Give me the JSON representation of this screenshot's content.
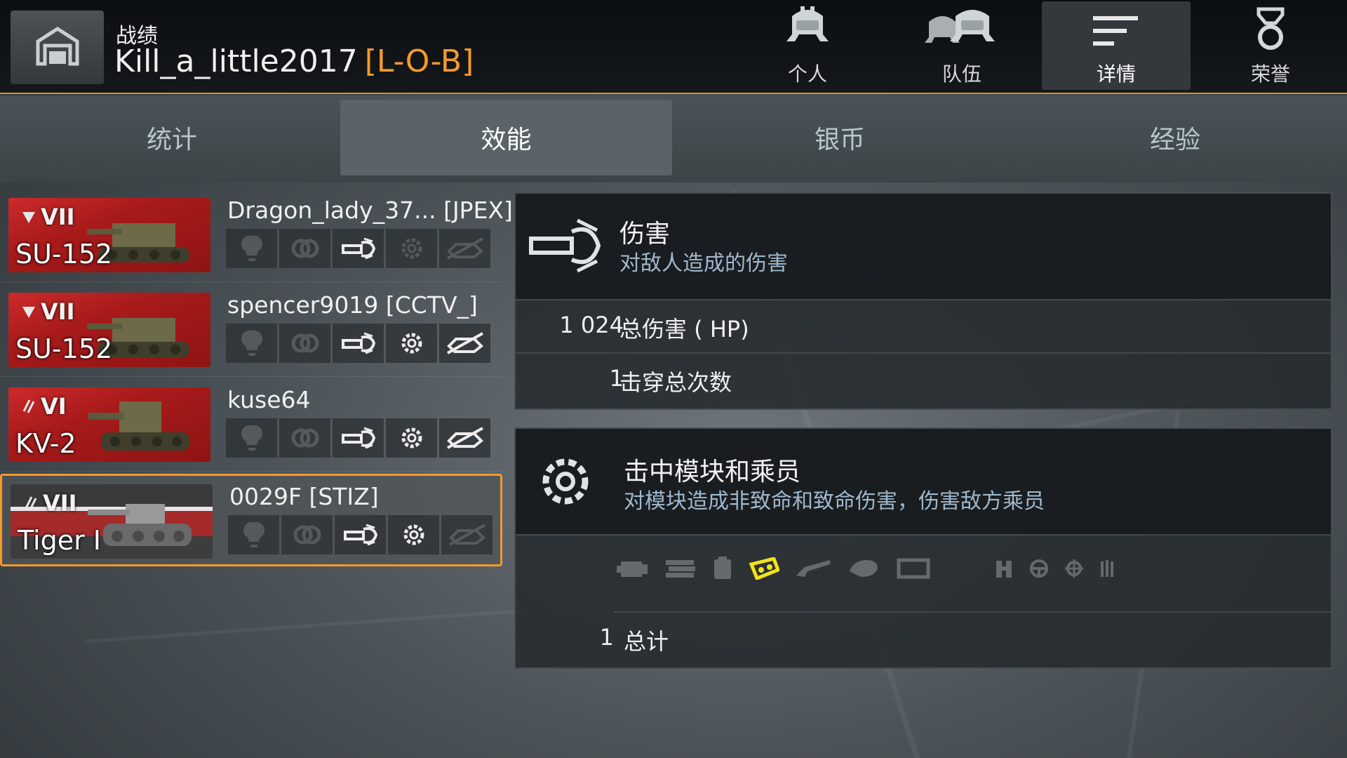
{
  "header": {
    "section": "战绩",
    "player_name": "Kill_a_little2017",
    "player_clan": "[L-O-B]"
  },
  "top_tabs": [
    {
      "label": "个人",
      "icon": "single-helmet-icon",
      "active": false
    },
    {
      "label": "队伍",
      "icon": "team-helmets-icon",
      "active": false
    },
    {
      "label": "详情",
      "icon": "details-lines-icon",
      "active": true
    },
    {
      "label": "荣誉",
      "icon": "medal-icon",
      "active": false
    }
  ],
  "sub_tabs": [
    {
      "label": "统计",
      "active": false
    },
    {
      "label": "效能",
      "active": true
    },
    {
      "label": "银币",
      "active": false
    },
    {
      "label": "经验",
      "active": false
    }
  ],
  "vehicles": [
    {
      "tier": "VII",
      "vehicle": "SU-152",
      "nation": "ussr",
      "player": "Dragon_lady_37...  [JPEX]",
      "badges": {
        "spotting": false,
        "assist": false,
        "damage": true,
        "modules": false,
        "kill": false
      },
      "selected": false
    },
    {
      "tier": "VII",
      "vehicle": "SU-152",
      "nation": "ussr",
      "player": "spencer9019 [CCTV_]",
      "badges": {
        "spotting": false,
        "assist": false,
        "damage": true,
        "modules": true,
        "kill": true
      },
      "selected": false
    },
    {
      "tier": "VI",
      "vehicle": "KV-2",
      "nation": "ussr",
      "player": "kuse64",
      "badges": {
        "spotting": false,
        "assist": false,
        "damage": true,
        "modules": true,
        "kill": true
      },
      "selected": false
    },
    {
      "tier": "VII",
      "vehicle": "Tiger I",
      "nation": "germany",
      "player": "0029F [STIZ]",
      "badges": {
        "spotting": false,
        "assist": false,
        "damage": true,
        "modules": true,
        "kill": false
      },
      "selected": true
    }
  ],
  "damage_panel": {
    "title": "伤害",
    "subtitle": "对敌人造成的伤害",
    "rows": [
      {
        "value": "1 024",
        "label": "总伤害 ( HP)"
      },
      {
        "value": "1",
        "label": "击穿总次数"
      }
    ]
  },
  "modules_panel": {
    "title": "击中模块和乘员",
    "subtitle": "对模块造成非致命和致命伤害，伤害敌方乘员",
    "module_icons": [
      "engine-icon",
      "ammo-rack-icon",
      "fuel-tank-icon",
      "track-icon",
      "gun-icon",
      "turret-icon",
      "radio-icon",
      "commander-icon",
      "driver-icon",
      "gunner-icon",
      "loader-icon"
    ],
    "highlighted_module": "track-icon",
    "highlight_color": "#f2e31a",
    "total_value": "1",
    "total_label": "总计"
  },
  "colors": {
    "accent": "#f59a2a",
    "subtitle": "#9fb8cc"
  }
}
